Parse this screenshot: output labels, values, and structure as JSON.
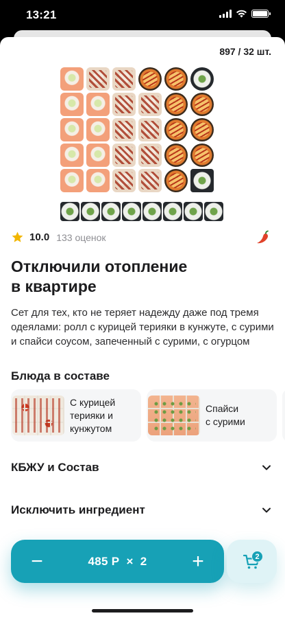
{
  "status_bar": {
    "time": "13:21"
  },
  "product": {
    "count_label": "897 / 32 шт.",
    "rating_value": "10.0",
    "rating_count": "133 оценок",
    "title_line1": "Отключили отопление",
    "title_line2": "в квартире",
    "description": "Сет для тех, кто не теряет надежду даже под тремя одеялами: ролл с курицей терияки в кунжуте, с сурими и спайси соусом, запеченный с сурими, с огурцом",
    "spicy_icon": "chili-pepper-icon"
  },
  "dishes": {
    "section_title": "Блюда в составе",
    "items": [
      {
        "line1": "С курицей",
        "line2": "терияки и",
        "line3": "кунжутом"
      },
      {
        "line1": "Спайси",
        "line2": "с сурими"
      }
    ]
  },
  "accordions": [
    {
      "label": "КБЖУ и Состав"
    },
    {
      "label": "Исключить ингредиент"
    }
  ],
  "cart": {
    "minus_label": "−",
    "plus_label": "+",
    "price_qty": "485 Р  ×  2",
    "badge_count": "2"
  },
  "colors": {
    "accent": "#17a1b6",
    "accent_light": "#dff3f6",
    "star": "#f2b600",
    "chili": "#e0422a"
  }
}
